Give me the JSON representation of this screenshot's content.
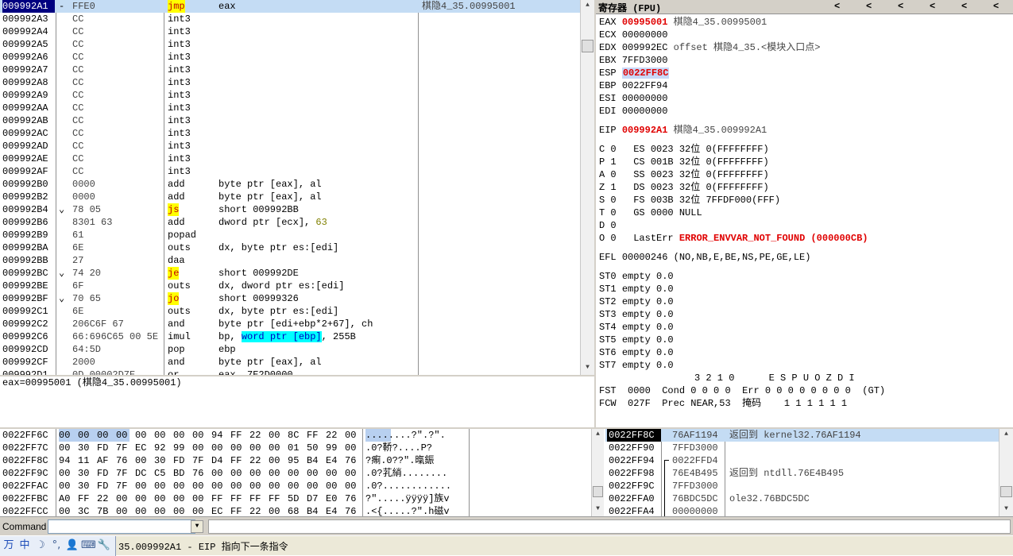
{
  "disasm": {
    "rows": [
      {
        "addr": "009992A1",
        "arrow": "-",
        "hex": "FFE0",
        "mn": "jmp",
        "hl": "yellow",
        "op": "eax",
        "cm": "棋隐4_35.00995001",
        "addr_sel": true,
        "row_sel": true
      },
      {
        "addr": "009992A3",
        "hex": "CC",
        "mn": "int3",
        "op": ""
      },
      {
        "addr": "009992A4",
        "hex": "CC",
        "mn": "int3",
        "op": ""
      },
      {
        "addr": "009992A5",
        "hex": "CC",
        "mn": "int3",
        "op": ""
      },
      {
        "addr": "009992A6",
        "hex": "CC",
        "mn": "int3",
        "op": ""
      },
      {
        "addr": "009992A7",
        "hex": "CC",
        "mn": "int3",
        "op": ""
      },
      {
        "addr": "009992A8",
        "hex": "CC",
        "mn": "int3",
        "op": ""
      },
      {
        "addr": "009992A9",
        "hex": "CC",
        "mn": "int3",
        "op": ""
      },
      {
        "addr": "009992AA",
        "hex": "CC",
        "mn": "int3",
        "op": ""
      },
      {
        "addr": "009992AB",
        "hex": "CC",
        "mn": "int3",
        "op": ""
      },
      {
        "addr": "009992AC",
        "hex": "CC",
        "mn": "int3",
        "op": ""
      },
      {
        "addr": "009992AD",
        "hex": "CC",
        "mn": "int3",
        "op": ""
      },
      {
        "addr": "009992AE",
        "hex": "CC",
        "mn": "int3",
        "op": ""
      },
      {
        "addr": "009992AF",
        "hex": "CC",
        "mn": "int3",
        "op": ""
      },
      {
        "addr": "009992B0",
        "hex": "0000",
        "mn": "add",
        "op": "byte ptr [eax], al"
      },
      {
        "addr": "009992B2",
        "hex": "0000",
        "mn": "add",
        "op": "byte ptr [eax], al"
      },
      {
        "addr": "009992B4",
        "arrow": "⌄",
        "hex": "78 05",
        "mn": "js",
        "hl": "yellow",
        "op": "short 009992BB"
      },
      {
        "addr": "009992B6",
        "hex": "8301 63",
        "mn": "add",
        "op": "dword ptr [ecx], ",
        "op2": "63"
      },
      {
        "addr": "009992B9",
        "hex": "61",
        "mn": "popad",
        "op": ""
      },
      {
        "addr": "009992BA",
        "hex": "6E",
        "mn": "outs",
        "op": "dx, byte ptr es:[edi]"
      },
      {
        "addr": "009992BB",
        "hex": "27",
        "mn": "daa",
        "op": ""
      },
      {
        "addr": "009992BC",
        "arrow": "⌄",
        "hex": "74 20",
        "mn": "je",
        "hl": "yellow",
        "op": "short 009992DE"
      },
      {
        "addr": "009992BE",
        "hex": "6F",
        "mn": "outs",
        "op": "dx, dword ptr es:[edi]"
      },
      {
        "addr": "009992BF",
        "arrow": "⌄",
        "hex": "70 65",
        "mn": "jo",
        "hl": "yellow",
        "op": "short 00999326"
      },
      {
        "addr": "009992C1",
        "hex": "6E",
        "mn": "outs",
        "op": "dx, byte ptr es:[edi]"
      },
      {
        "addr": "009992C2",
        "hex": "206C6F 67",
        "mn": "and",
        "op": "byte ptr [edi+ebp*2+67], ch"
      },
      {
        "addr": "009992C6",
        "hex": "66:696C65 00 5E",
        "mn": "imul",
        "op": "bp, ",
        "opc": "word ptr [ebp]",
        "op2": ", 255B"
      },
      {
        "addr": "009992CD",
        "hex": "64:5D",
        "mn": "pop",
        "op": "ebp"
      },
      {
        "addr": "009992CF",
        "hex": "2000",
        "mn": "and",
        "op": "byte ptr [eax], al"
      },
      {
        "addr": "009992D1",
        "hex": "0D 00002D7E",
        "mn": "or",
        "op": "eax, 7E2D0000"
      }
    ]
  },
  "info": {
    "text": "eax=00995001 (棋隐4_35.00995001)"
  },
  "regs": {
    "title": "寄存器 (FPU)",
    "arrows": [
      "<",
      "<",
      "<",
      "<",
      "<",
      "<"
    ],
    "gpr": [
      {
        "name": "EAX",
        "val": "00995001",
        "extra": "棋隐4_35.00995001",
        "red": true
      },
      {
        "name": "ECX",
        "val": "00000000",
        "extra": ""
      },
      {
        "name": "EDX",
        "val": "009992EC",
        "extra": "offset 棋隐4_35.<模块入口点>"
      },
      {
        "name": "EBX",
        "val": "7FFD3000",
        "extra": ""
      },
      {
        "name": "ESP",
        "val": "0022FF8C",
        "extra": "",
        "red": true,
        "box": true
      },
      {
        "name": "EBP",
        "val": "0022FF94",
        "extra": ""
      },
      {
        "name": "ESI",
        "val": "00000000",
        "extra": ""
      },
      {
        "name": "EDI",
        "val": "00000000",
        "extra": ""
      }
    ],
    "eip": {
      "name": "EIP",
      "val": "009992A1",
      "extra": "棋隐4_35.009992A1"
    },
    "flags": [
      {
        "f": "C",
        "v": "0",
        "s": "ES",
        "sv": "0023",
        "b": "32位",
        "r": "0(FFFFFFFF)"
      },
      {
        "f": "P",
        "v": "1",
        "s": "CS",
        "sv": "001B",
        "b": "32位",
        "r": "0(FFFFFFFF)"
      },
      {
        "f": "A",
        "v": "0",
        "s": "SS",
        "sv": "0023",
        "b": "32位",
        "r": "0(FFFFFFFF)"
      },
      {
        "f": "Z",
        "v": "1",
        "s": "DS",
        "sv": "0023",
        "b": "32位",
        "r": "0(FFFFFFFF)"
      },
      {
        "f": "S",
        "v": "0",
        "s": "FS",
        "sv": "003B",
        "b": "32位",
        "r": "7FFDF000(FFF)"
      },
      {
        "f": "T",
        "v": "0",
        "s": "GS",
        "sv": "0000",
        "b": "NULL",
        "r": ""
      },
      {
        "f": "D",
        "v": "0",
        "s": "",
        "sv": "",
        "b": "",
        "r": ""
      }
    ],
    "lasterr": {
      "f": "O",
      "v": "0",
      "label": "LastErr",
      "val": "ERROR_ENVVAR_NOT_FOUND (000000CB)"
    },
    "efl": {
      "label": "EFL",
      "val": "00000246",
      "desc": "(NO,NB,E,BE,NS,PE,GE,LE)"
    },
    "st": [
      {
        "name": "ST0",
        "val": "empty 0.0"
      },
      {
        "name": "ST1",
        "val": "empty 0.0"
      },
      {
        "name": "ST2",
        "val": "empty 0.0"
      },
      {
        "name": "ST3",
        "val": "empty 0.0"
      },
      {
        "name": "ST4",
        "val": "empty 0.0"
      },
      {
        "name": "ST5",
        "val": "empty 0.0"
      },
      {
        "name": "ST6",
        "val": "empty 0.0"
      },
      {
        "name": "ST7",
        "val": "empty 0.0"
      }
    ],
    "fpu_header": "3 2 1 0      E S P U O Z D I",
    "fst": {
      "label": "FST",
      "val": "0000",
      "cond": "Cond 0 0 0 0",
      "err": "Err 0 0 0 0 0 0 0 0",
      "gt": "(GT)"
    },
    "fcw": {
      "label": "FCW",
      "val": "027F",
      "prec": "Prec NEAR,53",
      "mask": "掩码",
      "bits": "1 1 1 1 1 1"
    }
  },
  "dump": {
    "rows": [
      {
        "addr": "0022FF6C",
        "hex": [
          "00",
          "00",
          "00",
          "00",
          "00",
          "00",
          "00",
          "00",
          "94",
          "FF",
          "22",
          "00",
          "8C",
          "FF",
          "22",
          "00"
        ],
        "asc": "........?\".?\".",
        "sel": 4
      },
      {
        "addr": "0022FF7C",
        "hex": [
          "00",
          "30",
          "FD",
          "7F",
          "EC",
          "92",
          "99",
          "00",
          "00",
          "00",
          "00",
          "00",
          "01",
          "50",
          "99",
          "00"
        ],
        "asc": ".0?鞒?....P?"
      },
      {
        "addr": "0022FF8C",
        "hex": [
          "94",
          "11",
          "AF",
          "76",
          "00",
          "30",
          "FD",
          "7F",
          "D4",
          "FF",
          "22",
          "00",
          "95",
          "B4",
          "E4",
          "76"
        ],
        "asc": "?痸.0??\".暣鋠"
      },
      {
        "addr": "0022FF9C",
        "hex": [
          "00",
          "30",
          "FD",
          "7F",
          "DC",
          "C5",
          "BD",
          "76",
          "00",
          "00",
          "00",
          "00",
          "00",
          "00",
          "00",
          "00"
        ],
        "asc": ".0?芤綃........"
      },
      {
        "addr": "0022FFAC",
        "hex": [
          "00",
          "30",
          "FD",
          "7F",
          "00",
          "00",
          "00",
          "00",
          "00",
          "00",
          "00",
          "00",
          "00",
          "00",
          "00",
          "00"
        ],
        "asc": ".0?............"
      },
      {
        "addr": "0022FFBC",
        "hex": [
          "A0",
          "FF",
          "22",
          "00",
          "00",
          "00",
          "00",
          "00",
          "FF",
          "FF",
          "FF",
          "FF",
          "5D",
          "D7",
          "E0",
          "76"
        ],
        "asc": "?\".....ÿÿÿÿ]族v"
      },
      {
        "addr": "0022FFCC",
        "hex": [
          "00",
          "3C",
          "7B",
          "00",
          "00",
          "00",
          "00",
          "00",
          "EC",
          "FF",
          "22",
          "00",
          "68",
          "B4",
          "E4",
          "76"
        ],
        "asc": ".<{.....?\".h磁v"
      }
    ]
  },
  "stack": {
    "rows": [
      {
        "addr": "0022FF8C",
        "val": "76AF1194",
        "cm": "返回到 kernel32.76AF1194",
        "sel": true
      },
      {
        "addr": "0022FF90",
        "val": "7FFD3000",
        "cm": ""
      },
      {
        "addr": "0022FF94",
        "val": "0022FFD4",
        "cm": "",
        "bracket": "top"
      },
      {
        "addr": "0022FF98",
        "val": "76E4B495",
        "cm": "返回到 ntdll.76E4B495",
        "bracket": "mid"
      },
      {
        "addr": "0022FF9C",
        "val": "7FFD3000",
        "cm": "",
        "bracket": "mid"
      },
      {
        "addr": "0022FFA0",
        "val": "76BDC5DC",
        "cm": "ole32.76BDC5DC",
        "bracket": "mid"
      },
      {
        "addr": "0022FFA4",
        "val": "00000000",
        "cm": "",
        "bracket": "mid"
      }
    ]
  },
  "command": {
    "label": "Command",
    "value": ""
  },
  "status": {
    "icons": [
      "万",
      "中",
      "☽",
      "°,",
      "👤",
      "⌨",
      "🔧"
    ],
    "text": "35.009992A1 - EIP 指向下一条指令"
  }
}
